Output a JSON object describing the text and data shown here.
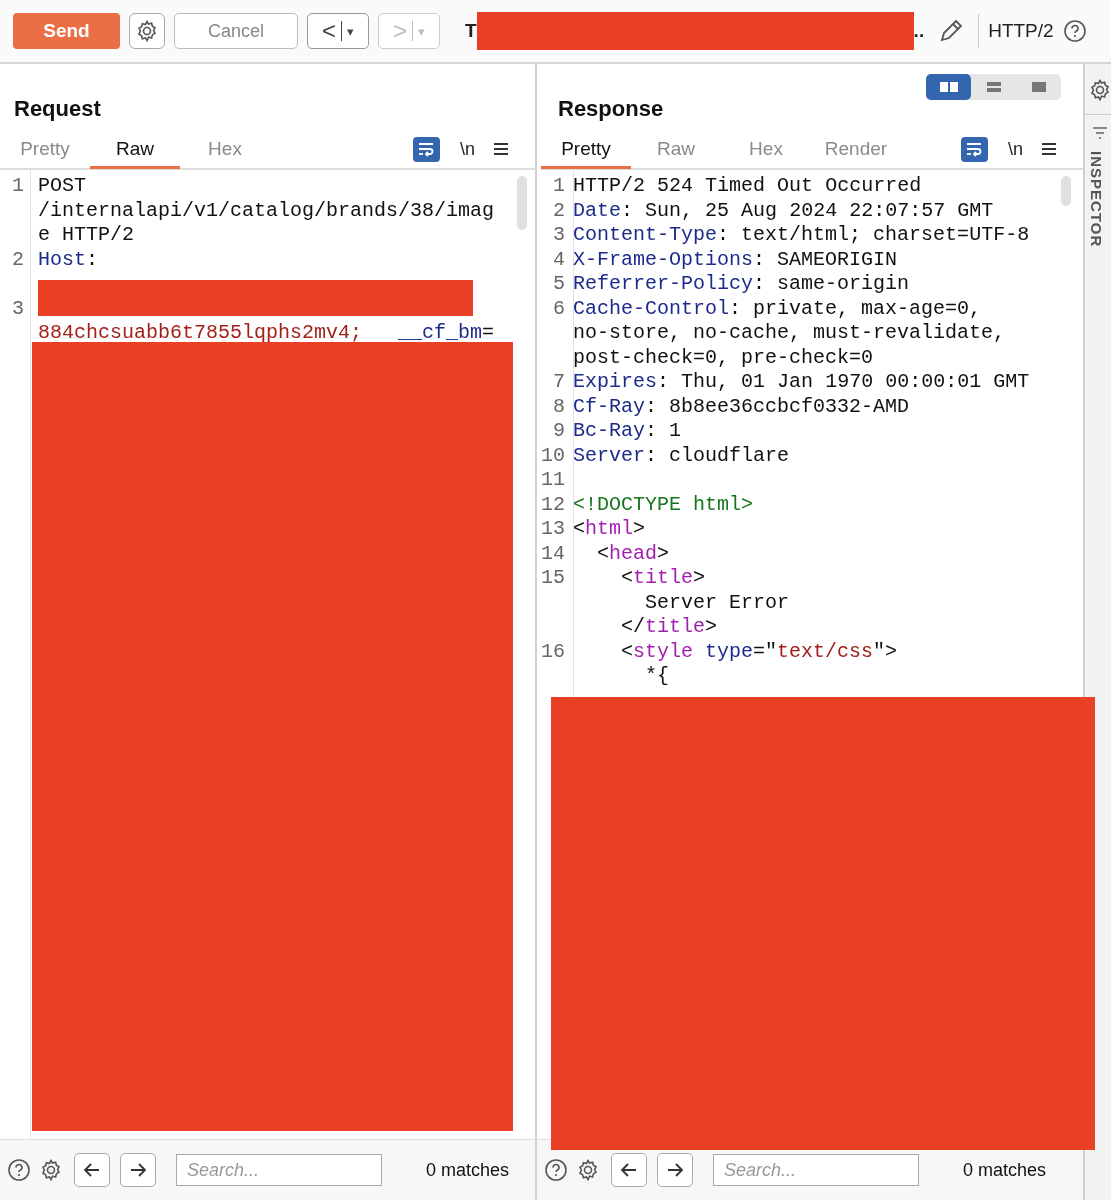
{
  "toolbar": {
    "send": "Send",
    "cancel": "Cancel",
    "back": {
      "arrow": "<",
      "caret": "▾",
      "disabled": false
    },
    "forward": {
      "arrow": ">",
      "caret": "▾",
      "disabled": true
    },
    "target_prefix": "T",
    "target_suffix": "..",
    "protocol": "HTTP/2"
  },
  "layout_toggle": [
    {
      "kind": "side",
      "selected": true
    },
    {
      "kind": "stacked",
      "selected": false
    },
    {
      "kind": "single",
      "selected": false
    }
  ],
  "request": {
    "title": "Request",
    "tabs": [
      {
        "label": "Pretty",
        "selected": false
      },
      {
        "label": "Raw",
        "selected": true
      },
      {
        "label": "Hex",
        "selected": false
      }
    ],
    "newline_label": "\\n",
    "lines": [
      {
        "number": "1",
        "rows": [
          {
            "kind": "code",
            "segments": [
              {
                "kind": "plain",
                "text": "POST /internalapi/v1/catalog/brands/38/image HTTP/2"
              }
            ]
          }
        ]
      },
      {
        "number": "2",
        "rows": [
          {
            "kind": "code",
            "segments": [
              {
                "kind": "header",
                "text": "Host"
              },
              {
                "kind": "plain",
                "text": ":"
              }
            ]
          },
          {
            "kind": "hidden"
          }
        ]
      },
      {
        "number": "3",
        "rows": [
          {
            "kind": "hidden"
          },
          {
            "kind": "code",
            "segments": [
              {
                "kind": "value",
                "text": "884chcsuabb6t7855lqphs2mv4;"
              },
              {
                "kind": "header",
                "text": "   __cf_bm"
              },
              {
                "kind": "plain",
                "text": "="
              }
            ]
          }
        ]
      }
    ],
    "search": {
      "placeholder": "Search...",
      "matches": "0 matches"
    }
  },
  "response": {
    "title": "Response",
    "tabs": [
      {
        "label": "Pretty",
        "selected": true
      },
      {
        "label": "Raw",
        "selected": false
      },
      {
        "label": "Hex",
        "selected": false
      },
      {
        "label": "Render",
        "selected": false
      }
    ],
    "newline_label": "\\n",
    "lines": [
      {
        "number": "1",
        "rows": [
          {
            "kind": "code",
            "segments": [
              {
                "kind": "plain",
                "text": "HTTP/2 524 Timed Out Occurred"
              }
            ]
          }
        ]
      },
      {
        "number": "2",
        "rows": [
          {
            "kind": "code",
            "segments": [
              {
                "kind": "header",
                "text": "Date"
              },
              {
                "kind": "plain",
                "text": ": Sun, 25 Aug 2024 22:07:57 GMT"
              }
            ]
          }
        ]
      },
      {
        "number": "3",
        "rows": [
          {
            "kind": "code",
            "segments": [
              {
                "kind": "header",
                "text": "Content-Type"
              },
              {
                "kind": "plain",
                "text": ": text/html; charset=UTF-8"
              }
            ]
          }
        ]
      },
      {
        "number": "4",
        "rows": [
          {
            "kind": "code",
            "segments": [
              {
                "kind": "header",
                "text": "X-Frame-Options"
              },
              {
                "kind": "plain",
                "text": ": SAMEORIGIN"
              }
            ]
          }
        ]
      },
      {
        "number": "5",
        "rows": [
          {
            "kind": "code",
            "segments": [
              {
                "kind": "header",
                "text": "Referrer-Policy"
              },
              {
                "kind": "plain",
                "text": ": same-origin"
              }
            ]
          }
        ]
      },
      {
        "number": "6",
        "rows": [
          {
            "kind": "code",
            "segments": [
              {
                "kind": "header",
                "text": "Cache-Control"
              },
              {
                "kind": "plain",
                "text": ": private, max-age=0, no-store, no-cache, must-revalidate, post-check=0, pre-check=0"
              }
            ]
          }
        ]
      },
      {
        "number": "7",
        "rows": [
          {
            "kind": "code",
            "segments": [
              {
                "kind": "header",
                "text": "Expires"
              },
              {
                "kind": "plain",
                "text": ": Thu, 01 Jan 1970 00:00:01 GMT"
              }
            ]
          }
        ]
      },
      {
        "number": "8",
        "rows": [
          {
            "kind": "code",
            "segments": [
              {
                "kind": "header",
                "text": "Cf-Ray"
              },
              {
                "kind": "plain",
                "text": ": 8b8ee36ccbcf0332-AMD"
              }
            ]
          }
        ]
      },
      {
        "number": "9",
        "rows": [
          {
            "kind": "code",
            "segments": [
              {
                "kind": "header",
                "text": "Bc-Ray"
              },
              {
                "kind": "plain",
                "text": ": 1"
              }
            ]
          }
        ]
      },
      {
        "number": "10",
        "rows": [
          {
            "kind": "code",
            "segments": [
              {
                "kind": "header",
                "text": "Server"
              },
              {
                "kind": "plain",
                "text": ": cloudflare"
              }
            ]
          }
        ]
      },
      {
        "number": "11",
        "rows": [
          {
            "kind": "hidden"
          }
        ]
      },
      {
        "number": "12",
        "rows": [
          {
            "kind": "code",
            "segments": [
              {
                "kind": "doctype",
                "text": "<!DOCTYPE html>"
              }
            ]
          }
        ]
      },
      {
        "number": "13",
        "rows": [
          {
            "kind": "code",
            "segments": [
              {
                "kind": "plain",
                "text": "<"
              },
              {
                "kind": "tag",
                "text": "html"
              },
              {
                "kind": "plain",
                "text": ">"
              }
            ]
          }
        ]
      },
      {
        "number": "14",
        "rows": [
          {
            "kind": "code",
            "segments": [
              {
                "kind": "plain",
                "text": "  <"
              },
              {
                "kind": "tag",
                "text": "head"
              },
              {
                "kind": "plain",
                "text": ">"
              }
            ]
          }
        ]
      },
      {
        "number": "15",
        "rows": [
          {
            "kind": "code",
            "segments": [
              {
                "kind": "plain",
                "text": "    <"
              },
              {
                "kind": "tag",
                "text": "title"
              },
              {
                "kind": "plain",
                "text": ">"
              }
            ]
          },
          {
            "kind": "code",
            "segments": [
              {
                "kind": "plain",
                "text": "      Server Error"
              }
            ]
          },
          {
            "kind": "code",
            "segments": [
              {
                "kind": "plain",
                "text": "    </"
              },
              {
                "kind": "tag",
                "text": "title"
              },
              {
                "kind": "plain",
                "text": ">"
              }
            ]
          }
        ]
      },
      {
        "number": "16",
        "rows": [
          {
            "kind": "code",
            "segments": [
              {
                "kind": "plain",
                "text": "    <"
              },
              {
                "kind": "tag",
                "text": "style"
              },
              {
                "kind": "header",
                "text": " type"
              },
              {
                "kind": "plain",
                "text": "=\""
              },
              {
                "kind": "value",
                "text": "text/css"
              },
              {
                "kind": "plain",
                "text": "\">"
              }
            ]
          },
          {
            "kind": "code",
            "segments": [
              {
                "kind": "plain",
                "text": "      *{"
              }
            ]
          }
        ]
      }
    ],
    "search": {
      "placeholder": "Search...",
      "matches": "0 matches"
    }
  },
  "inspector": {
    "label": "INSPECTOR"
  }
}
